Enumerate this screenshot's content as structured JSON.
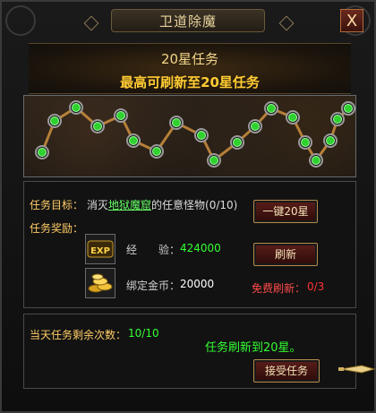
{
  "window": {
    "title": "卫道除魔",
    "close_label": "X"
  },
  "header": {
    "title": "20星任务",
    "subtitle": "最高可刷新至20星任务"
  },
  "progress": {
    "stars_total": 20,
    "stars_lit": 20
  },
  "task": {
    "target_label": "任务目标：",
    "target_prefix": "消灭",
    "target_link": "地狱魔窟",
    "target_suffix": "的任意怪物(0/10)",
    "reward_label": "任务奖励：",
    "exp_icon_text": "EXP",
    "exp_label": "经　　验：",
    "exp_value": "424000",
    "gold_label": "绑定金币：",
    "gold_value": "20000",
    "one_key_button": "一键20星",
    "refresh_button": "刷新",
    "free_refresh_label": "免费刷新：",
    "free_refresh_value": "0/3"
  },
  "daily": {
    "remaining_label": "当天任务剩余次数：",
    "remaining_value": "10/10",
    "notice": "任务刷新到20星。",
    "accept_button": "接受任务"
  },
  "colors": {
    "gold": "#ffcc33",
    "green": "#33ff33",
    "red": "#ff3333"
  },
  "icons": [
    "close-icon",
    "exp-icon",
    "gold-coins-icon",
    "sword-pointer-icon"
  ]
}
